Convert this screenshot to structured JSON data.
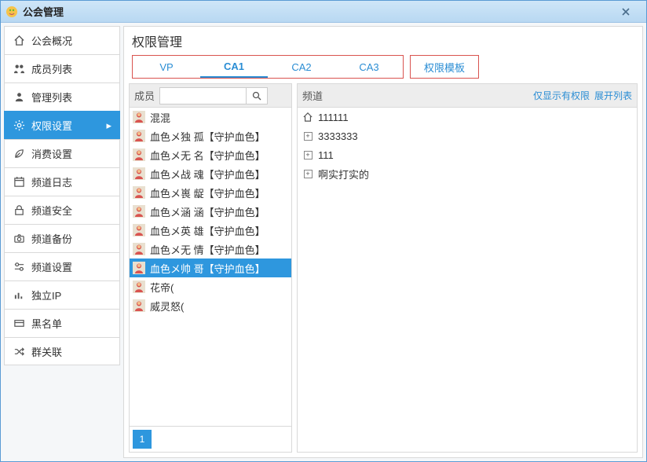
{
  "window": {
    "title": "公会管理"
  },
  "sidebar": {
    "items": [
      {
        "label": "公会概况",
        "icon": "home"
      },
      {
        "label": "成员列表",
        "icon": "users"
      },
      {
        "label": "管理列表",
        "icon": "user"
      },
      {
        "label": "权限设置",
        "icon": "gear",
        "active": true
      },
      {
        "label": "消费设置",
        "icon": "leaf"
      },
      {
        "label": "频道日志",
        "icon": "calendar"
      },
      {
        "label": "频道安全",
        "icon": "lock"
      },
      {
        "label": "频道备份",
        "icon": "camera"
      },
      {
        "label": "频道设置",
        "icon": "sliders"
      },
      {
        "label": "独立IP",
        "icon": "chart"
      },
      {
        "label": "黑名单",
        "icon": "card"
      },
      {
        "label": "群关联",
        "icon": "shuffle"
      }
    ]
  },
  "main": {
    "heading": "权限管理",
    "tabs_group1": [
      "VP",
      "CA1",
      "CA2",
      "CA3"
    ],
    "tabs_group1_active_index": 1,
    "tabs_group2": [
      "权限模板"
    ]
  },
  "members_panel": {
    "label": "成员",
    "search_placeholder": "",
    "pagination": {
      "current": "1"
    },
    "items": [
      {
        "name": "混混",
        "selected": false
      },
      {
        "name": "血色メ独  孤【守护血色】",
        "selected": false
      },
      {
        "name": "血色メ无  名【守护血色】",
        "selected": false
      },
      {
        "name": "血色メ战  魂【守护血色】",
        "selected": false
      },
      {
        "name": "血色メ嵔  龊【守护血色】",
        "selected": false
      },
      {
        "name": "血色メ涵  涵【守护血色】",
        "selected": false
      },
      {
        "name": "血色メ英  雄【守护血色】",
        "selected": false
      },
      {
        "name": "血色メ无  情【守护血色】",
        "selected": false
      },
      {
        "name": "血色メ帅  哥【守护血色】",
        "selected": true
      },
      {
        "name": "花帝(",
        "selected": false
      },
      {
        "name": "威灵怒(",
        "selected": false
      }
    ]
  },
  "channels_panel": {
    "label": "频道",
    "link_filter": "仅显示有权限",
    "link_expand": "展开列表",
    "items": [
      {
        "name": "111111",
        "icon": "home"
      },
      {
        "name": "3333333",
        "icon": "plus"
      },
      {
        "name": "111",
        "icon": "plus"
      },
      {
        "name": "啊实打实的",
        "icon": "plus"
      }
    ]
  }
}
